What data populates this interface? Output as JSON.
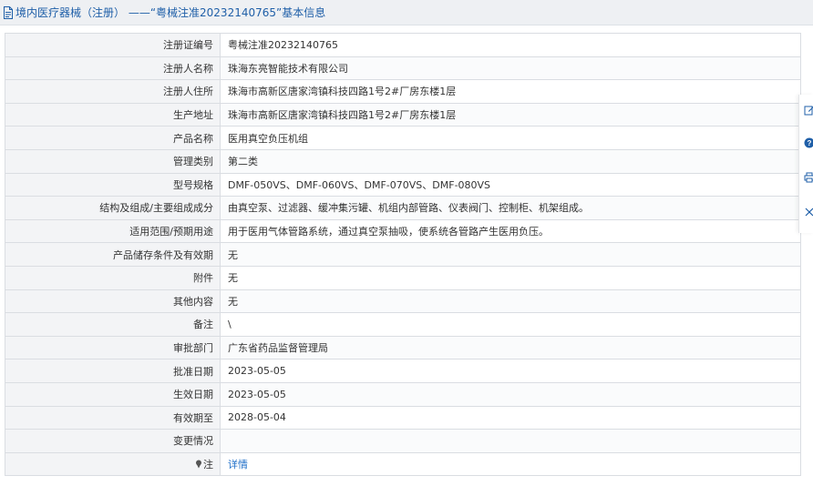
{
  "header": {
    "title": "境内医疗器械（注册） ——“粤械注准20232140765”基本信息",
    "icon": "document-icon"
  },
  "rows": [
    {
      "label": "注册证编号",
      "value": "粤械注准20232140765"
    },
    {
      "label": "注册人名称",
      "value": "珠海东亮智能技术有限公司"
    },
    {
      "label": "注册人住所",
      "value": "珠海市高新区唐家湾镇科技四路1号2#厂房东楼1层"
    },
    {
      "label": "生产地址",
      "value": "珠海市高新区唐家湾镇科技四路1号2#厂房东楼1层"
    },
    {
      "label": "产品名称",
      "value": "医用真空负压机组"
    },
    {
      "label": "管理类别",
      "value": "第二类"
    },
    {
      "label": "型号规格",
      "value": "DMF-050VS、DMF-060VS、DMF-070VS、DMF-080VS"
    },
    {
      "label": "结构及组成/主要组成成分",
      "value": "由真空泵、过滤器、缓冲集污罐、机组内部管路、仪表阀门、控制柜、机架组成。"
    },
    {
      "label": "适用范围/预期用途",
      "value": "用于医用气体管路系统，通过真空泵抽吸，使系统各管路产生医用负压。"
    },
    {
      "label": "产品储存条件及有效期",
      "value": "无"
    },
    {
      "label": "附件",
      "value": "无"
    },
    {
      "label": "其他内容",
      "value": "无"
    },
    {
      "label": "备注",
      "value": "\\"
    },
    {
      "label": "审批部门",
      "value": "广东省药品监督管理局"
    },
    {
      "label": "批准日期",
      "value": "2023-05-05"
    },
    {
      "label": "生效日期",
      "value": "2023-05-05"
    },
    {
      "label": "有效期至",
      "value": "2028-05-04"
    },
    {
      "label": "变更情况",
      "value": ""
    }
  ],
  "note_row": {
    "label": "注",
    "link_text": "详情",
    "icon": "pin-icon"
  },
  "side_toolbar": [
    "edit-icon",
    "help-icon",
    "print-icon",
    "close-icon"
  ],
  "colors": {
    "link": "#1f6fc8",
    "title": "#1f5fa8",
    "label_bg": "#f3f4f6",
    "border": "#dadde2"
  }
}
